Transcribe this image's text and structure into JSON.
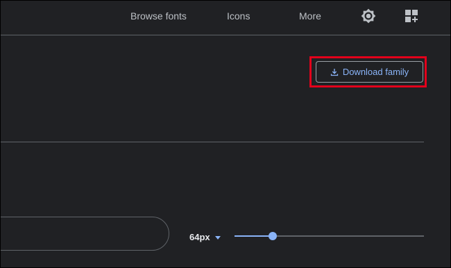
{
  "nav": {
    "browse_fonts": "Browse fonts",
    "icons": "Icons",
    "more": "More",
    "theme_icon": "brightness-icon",
    "apps_icon": "apps-grid-icon"
  },
  "download": {
    "label": "Download family",
    "icon": "download-icon"
  },
  "preview": {
    "text": ""
  },
  "size_control": {
    "selected": "64px",
    "slider_fraction": 0.2
  },
  "colors": {
    "background": "#202124",
    "accent": "#8ab4f8",
    "highlight": "#e3001b",
    "nav_text": "#bdc1c6"
  }
}
